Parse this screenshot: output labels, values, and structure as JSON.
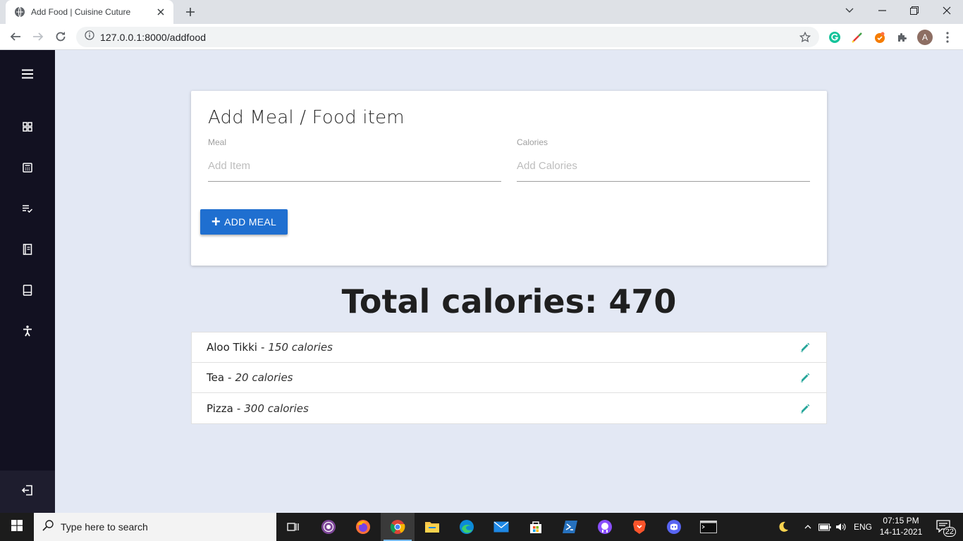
{
  "browser": {
    "tab_title": "Add Food | Cuisine Cuture",
    "url": "127.0.0.1:8000/addfood",
    "profile_initial": "A"
  },
  "sidebar": {
    "items": [
      {
        "icon": "menu-icon"
      },
      {
        "icon": "dashboard-icon"
      },
      {
        "icon": "calculator-icon"
      },
      {
        "icon": "playlist-check-icon"
      },
      {
        "icon": "book-icon"
      },
      {
        "icon": "tablet-icon"
      },
      {
        "icon": "accessibility-icon"
      },
      {
        "icon": "logout-icon"
      }
    ]
  },
  "form": {
    "title": "Add Meal / Food item",
    "meal_label": "Meal",
    "meal_placeholder": "Add Item",
    "meal_value": "",
    "calories_label": "Calories",
    "calories_placeholder": "Add Calories",
    "calories_value": "",
    "add_button": "ADD MEAL"
  },
  "total": "Total calories: 470",
  "meals": [
    {
      "name": "Aloo Tikki",
      "sep": "-",
      "calories": "150 calories"
    },
    {
      "name": "Tea",
      "sep": "-",
      "calories": "20 calories"
    },
    {
      "name": "Pizza",
      "sep": "-",
      "calories": "300 calories"
    }
  ],
  "taskbar": {
    "search_placeholder": "Type here to search",
    "language": "ENG",
    "time": "07:15 PM",
    "date": "14-11-2021",
    "notifications": "22"
  },
  "colors": {
    "sidebar": "#121121",
    "page_bg": "#e3e8f4",
    "button": "#1f6fd0",
    "edit_icon": "#26a69a"
  }
}
